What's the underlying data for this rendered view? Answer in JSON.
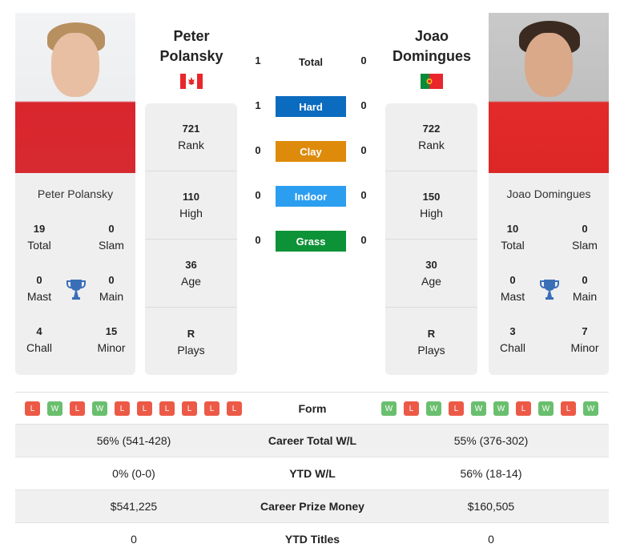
{
  "player1": {
    "name_line1": "Peter",
    "name_line2": "Polansky",
    "full_name": "Peter Polansky",
    "country": "Canada",
    "flag_icon": "canada-flag-icon",
    "titles": {
      "total": {
        "value": "19",
        "label": "Total"
      },
      "slam": {
        "value": "0",
        "label": "Slam"
      },
      "mast": {
        "value": "0",
        "label": "Mast"
      },
      "main": {
        "value": "0",
        "label": "Main"
      },
      "chall": {
        "value": "4",
        "label": "Chall"
      },
      "minor": {
        "value": "15",
        "label": "Minor"
      }
    },
    "info": [
      {
        "value": "721",
        "label": "Rank"
      },
      {
        "value": "110",
        "label": "High"
      },
      {
        "value": "36",
        "label": "Age"
      },
      {
        "value": "R",
        "label": "Plays"
      }
    ],
    "form": [
      "L",
      "W",
      "L",
      "W",
      "L",
      "L",
      "L",
      "L",
      "L",
      "L"
    ]
  },
  "player2": {
    "name_line1": "Joao",
    "name_line2": "Domingues",
    "full_name": "Joao Domingues",
    "country": "Portugal",
    "flag_icon": "portugal-flag-icon",
    "titles": {
      "total": {
        "value": "10",
        "label": "Total"
      },
      "slam": {
        "value": "0",
        "label": "Slam"
      },
      "mast": {
        "value": "0",
        "label": "Mast"
      },
      "main": {
        "value": "0",
        "label": "Main"
      },
      "chall": {
        "value": "3",
        "label": "Chall"
      },
      "minor": {
        "value": "7",
        "label": "Minor"
      }
    },
    "info": [
      {
        "value": "722",
        "label": "Rank"
      },
      {
        "value": "150",
        "label": "High"
      },
      {
        "value": "30",
        "label": "Age"
      },
      {
        "value": "R",
        "label": "Plays"
      }
    ],
    "form": [
      "W",
      "L",
      "W",
      "L",
      "W",
      "W",
      "L",
      "W",
      "L",
      "W"
    ]
  },
  "h2h": {
    "total": {
      "label": "Total",
      "p1": "1",
      "p2": "0"
    },
    "surfaces": [
      {
        "label": "Hard",
        "p1": "1",
        "p2": "0",
        "color": "#0b6bbf"
      },
      {
        "label": "Clay",
        "p1": "0",
        "p2": "0",
        "color": "#de8b0b"
      },
      {
        "label": "Indoor",
        "p1": "0",
        "p2": "0",
        "color": "#2c9ef0"
      },
      {
        "label": "Grass",
        "p1": "0",
        "p2": "0",
        "color": "#0e9238"
      }
    ]
  },
  "comparison": {
    "form_label": "Form",
    "rows": [
      {
        "label": "Career Total W/L",
        "p1": "56% (541-428)",
        "p2": "55% (376-302)"
      },
      {
        "label": "YTD W/L",
        "p1": "0% (0-0)",
        "p2": "56% (18-14)"
      },
      {
        "label": "Career Prize Money",
        "p1": "$541,225",
        "p2": "$160,505"
      },
      {
        "label": "YTD Titles",
        "p1": "0",
        "p2": "0"
      }
    ]
  },
  "colors": {
    "win": "#6abf6e",
    "loss": "#ec5a47",
    "trophy": "#3a6fb8"
  }
}
